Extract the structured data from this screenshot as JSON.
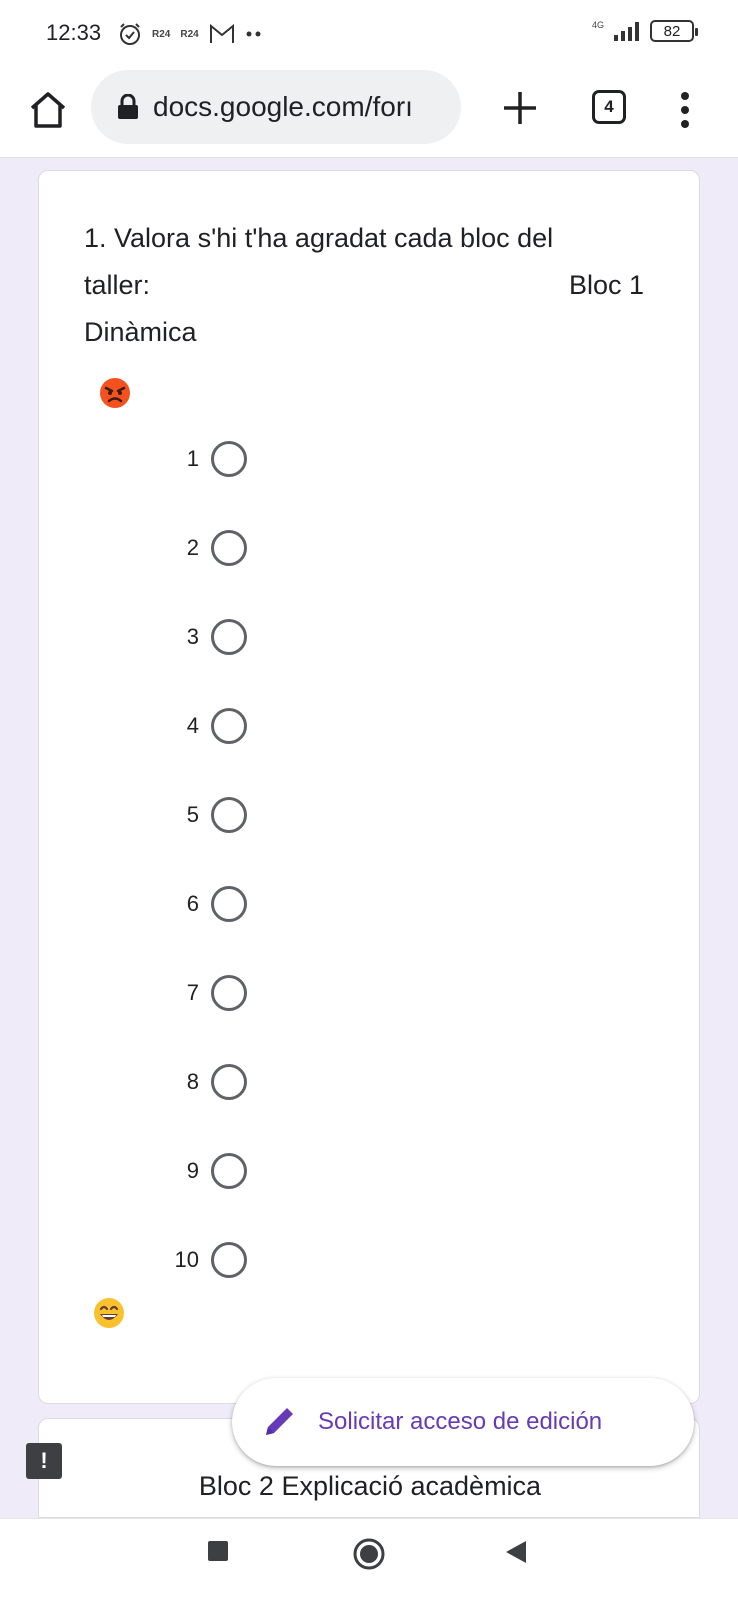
{
  "status_bar": {
    "time": "12:33",
    "notif_icons": [
      "alarm-icon",
      "r24-icon",
      "r24-icon",
      "gmail-icon",
      "more-dots-icon"
    ],
    "r24_label": "R24",
    "network": "4G",
    "battery": "82"
  },
  "browser": {
    "url": "docs.google.com/forı",
    "tab_count": "4"
  },
  "question": {
    "title_line1": "1. Valora s'hi t'ha agradat cada bloc del",
    "title_line2_left": "taller:",
    "title_line2_right": "Bloc 1",
    "title_line3": "Dinàmica",
    "top_emoji": "angry-face-icon",
    "bottom_emoji": "grinning-face-icon",
    "options": [
      {
        "label": "1",
        "selected": false
      },
      {
        "label": "2",
        "selected": false
      },
      {
        "label": "3",
        "selected": false
      },
      {
        "label": "4",
        "selected": false
      },
      {
        "label": "5",
        "selected": false
      },
      {
        "label": "6",
        "selected": false
      },
      {
        "label": "7",
        "selected": false
      },
      {
        "label": "8",
        "selected": false
      },
      {
        "label": "9",
        "selected": false
      },
      {
        "label": "10",
        "selected": false
      }
    ]
  },
  "next_question": {
    "title": "Bloc 2 Explicació acadèmica"
  },
  "request_edit": {
    "label": "Solicitar acceso de edición"
  },
  "report": {
    "label": "!"
  },
  "colors": {
    "accent": "#673ab7",
    "page_bg": "#f0ebf8",
    "radio_border": "#5f6368"
  }
}
